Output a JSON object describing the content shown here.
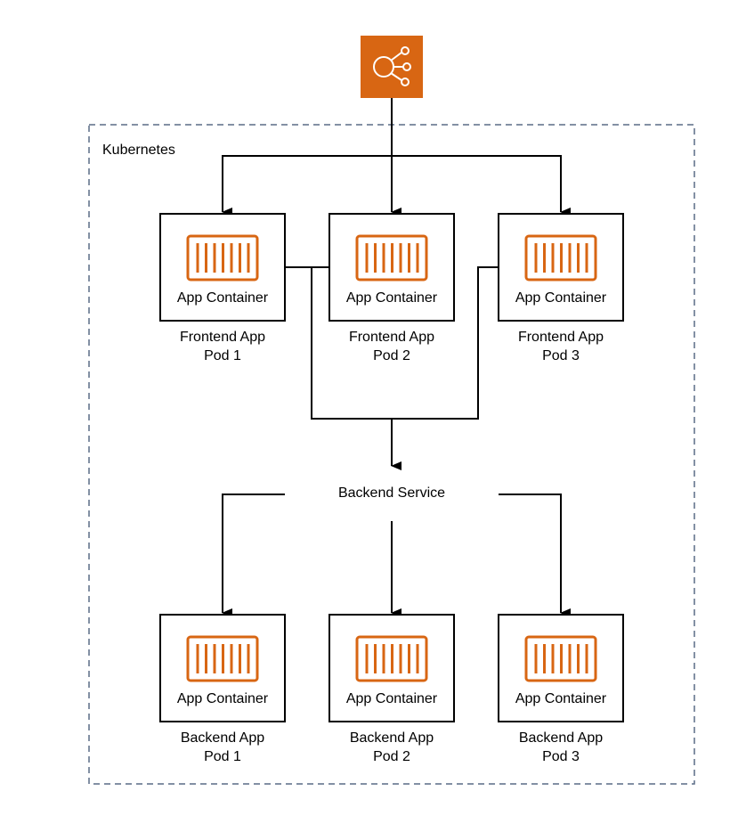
{
  "colors": {
    "accent": "#d86613",
    "cluster_border": "#5a6b86",
    "line": "#000000"
  },
  "load_balancer": {
    "icon": "load-balancer-icon"
  },
  "cluster": {
    "label": "Kubernetes"
  },
  "backend_service": {
    "label": "Backend Service"
  },
  "frontend_pods": [
    {
      "container": "App Container",
      "line1": "Frontend App",
      "line2": "Pod 1"
    },
    {
      "container": "App Container",
      "line1": "Frontend App",
      "line2": "Pod 2"
    },
    {
      "container": "App Container",
      "line1": "Frontend App",
      "line2": "Pod 3"
    }
  ],
  "backend_pods": [
    {
      "container": "App Container",
      "line1": "Backend App",
      "line2": "Pod 1"
    },
    {
      "container": "App Container",
      "line1": "Backend App",
      "line2": "Pod 2"
    },
    {
      "container": "App Container",
      "line1": "Backend App",
      "line2": "Pod 3"
    }
  ]
}
